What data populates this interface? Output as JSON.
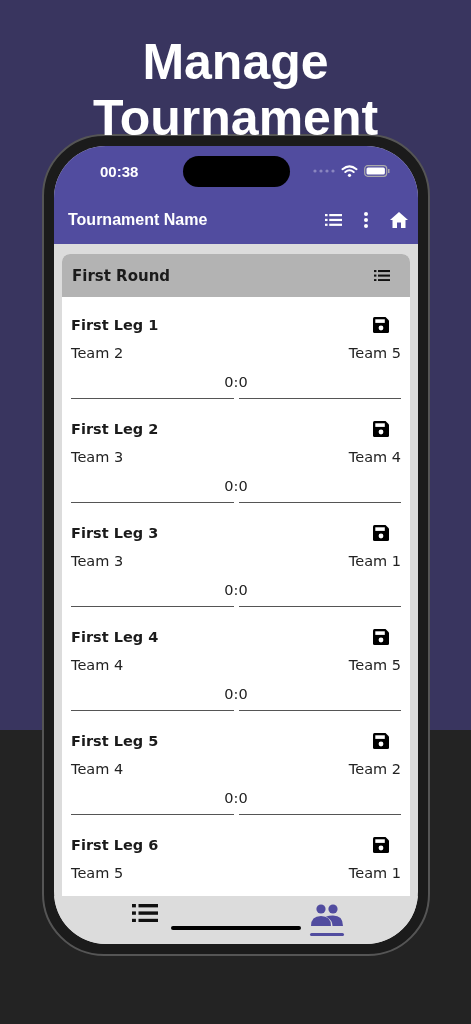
{
  "headline": [
    "Manage",
    "Tournament"
  ],
  "status_bar": {
    "time": "00:38"
  },
  "app_bar": {
    "title": "Tournament Name"
  },
  "round": {
    "title": "First Round"
  },
  "matches": [
    {
      "title": "First Leg 1",
      "home": "Team 2",
      "away": "Team 5",
      "score": "0:0"
    },
    {
      "title": "First Leg 2",
      "home": "Team 3",
      "away": "Team 4",
      "score": "0:0"
    },
    {
      "title": "First Leg 3",
      "home": "Team 3",
      "away": "Team 1",
      "score": "0:0"
    },
    {
      "title": "First Leg 4",
      "home": "Team 4",
      "away": "Team 5",
      "score": "0:0"
    },
    {
      "title": "First Leg 5",
      "home": "Team 4",
      "away": "Team 2",
      "score": "0:0"
    },
    {
      "title": "First Leg 6",
      "home": "Team 5",
      "away": "Team 1"
    }
  ],
  "bottom_nav": [
    {
      "kind": "list",
      "selected": false
    },
    {
      "kind": "teams",
      "selected": true
    }
  ]
}
